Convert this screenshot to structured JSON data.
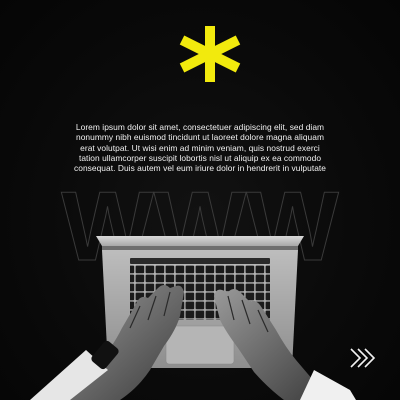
{
  "post": {
    "body_text": "Lorem ipsum dolor sit amet, consectetuer adipiscing elit, sed diam nonummy nibh euismod tincidunt ut laoreet dolore magna aliquam erat volutpat. Ut wisi enim ad minim veniam, quis nostrud exerci tation ullamcorper suscipit lobortis nisl ut aliquip ex ea commodo consequat. Duis autem vel eum iriure dolor in hendrerit in vulputate",
    "background_word": "WWW"
  },
  "colors": {
    "background": "#080808",
    "accent": "#f2ea0d",
    "text": "#f2f2f2"
  },
  "icons": {
    "top": "asterisk-icon",
    "next": "double-chevron-right-icon"
  }
}
